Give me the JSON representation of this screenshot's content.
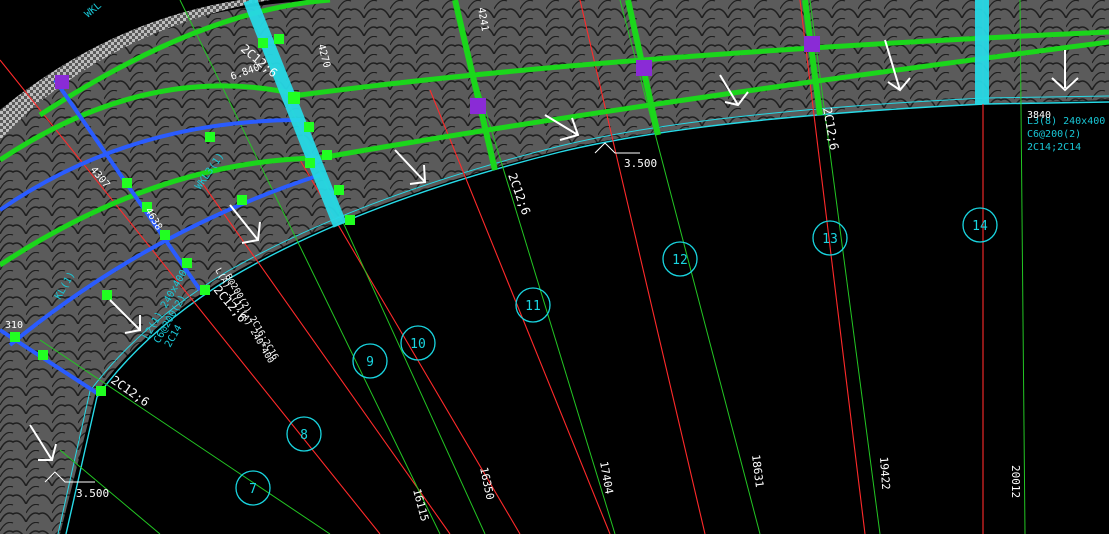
{
  "colors": {
    "background": "#000000",
    "slab": "#5b5b5b",
    "slab_hatch": "#1f1f1f",
    "beam_green": "#1bd61b",
    "beam_blue": "#2a5cff",
    "beam_cyan": "#27d9e6",
    "axis_red": "#ff2a2a",
    "dim_green": "#23c623",
    "bubble": "#19d5e0",
    "text_white": "#ffffff",
    "text_cyan": "#19c7d6",
    "column_green": "#21ff21",
    "column_purple": "#8a2bd6"
  },
  "axis_bubbles": [
    {
      "label": "7"
    },
    {
      "label": "8"
    },
    {
      "label": "9"
    },
    {
      "label": "10"
    },
    {
      "label": "11"
    },
    {
      "label": "12"
    },
    {
      "label": "13"
    },
    {
      "label": "14"
    }
  ],
  "radial_dimensions": [
    "16115",
    "16350",
    "17404",
    "18631",
    "19422",
    "20012"
  ],
  "elevations": [
    "3.500",
    "3.500"
  ],
  "rebar_tags": [
    "2C12;6",
    "2C12;6",
    "2C12;6",
    "2C12;6",
    "2C12;6"
  ],
  "beam_callout_L3": [
    "L3(8) 240x400",
    "C6@200(2)",
    "2C14;2C14"
  ],
  "beam_callout_L2": [
    "L2(1) 240x400",
    "C6@200(2)",
    "2C14"
  ],
  "beam_callout_radial": [
    "L(A) 1(1)(A) 240*400",
    "B@200(2) 2C16;2C16"
  ],
  "small_labels": [
    "4270",
    "4241",
    "3840",
    "4307",
    "4638",
    "310",
    "6.840"
  ],
  "side_notes": [
    "WKL",
    "KL(1)",
    "WKL3(1)"
  ]
}
